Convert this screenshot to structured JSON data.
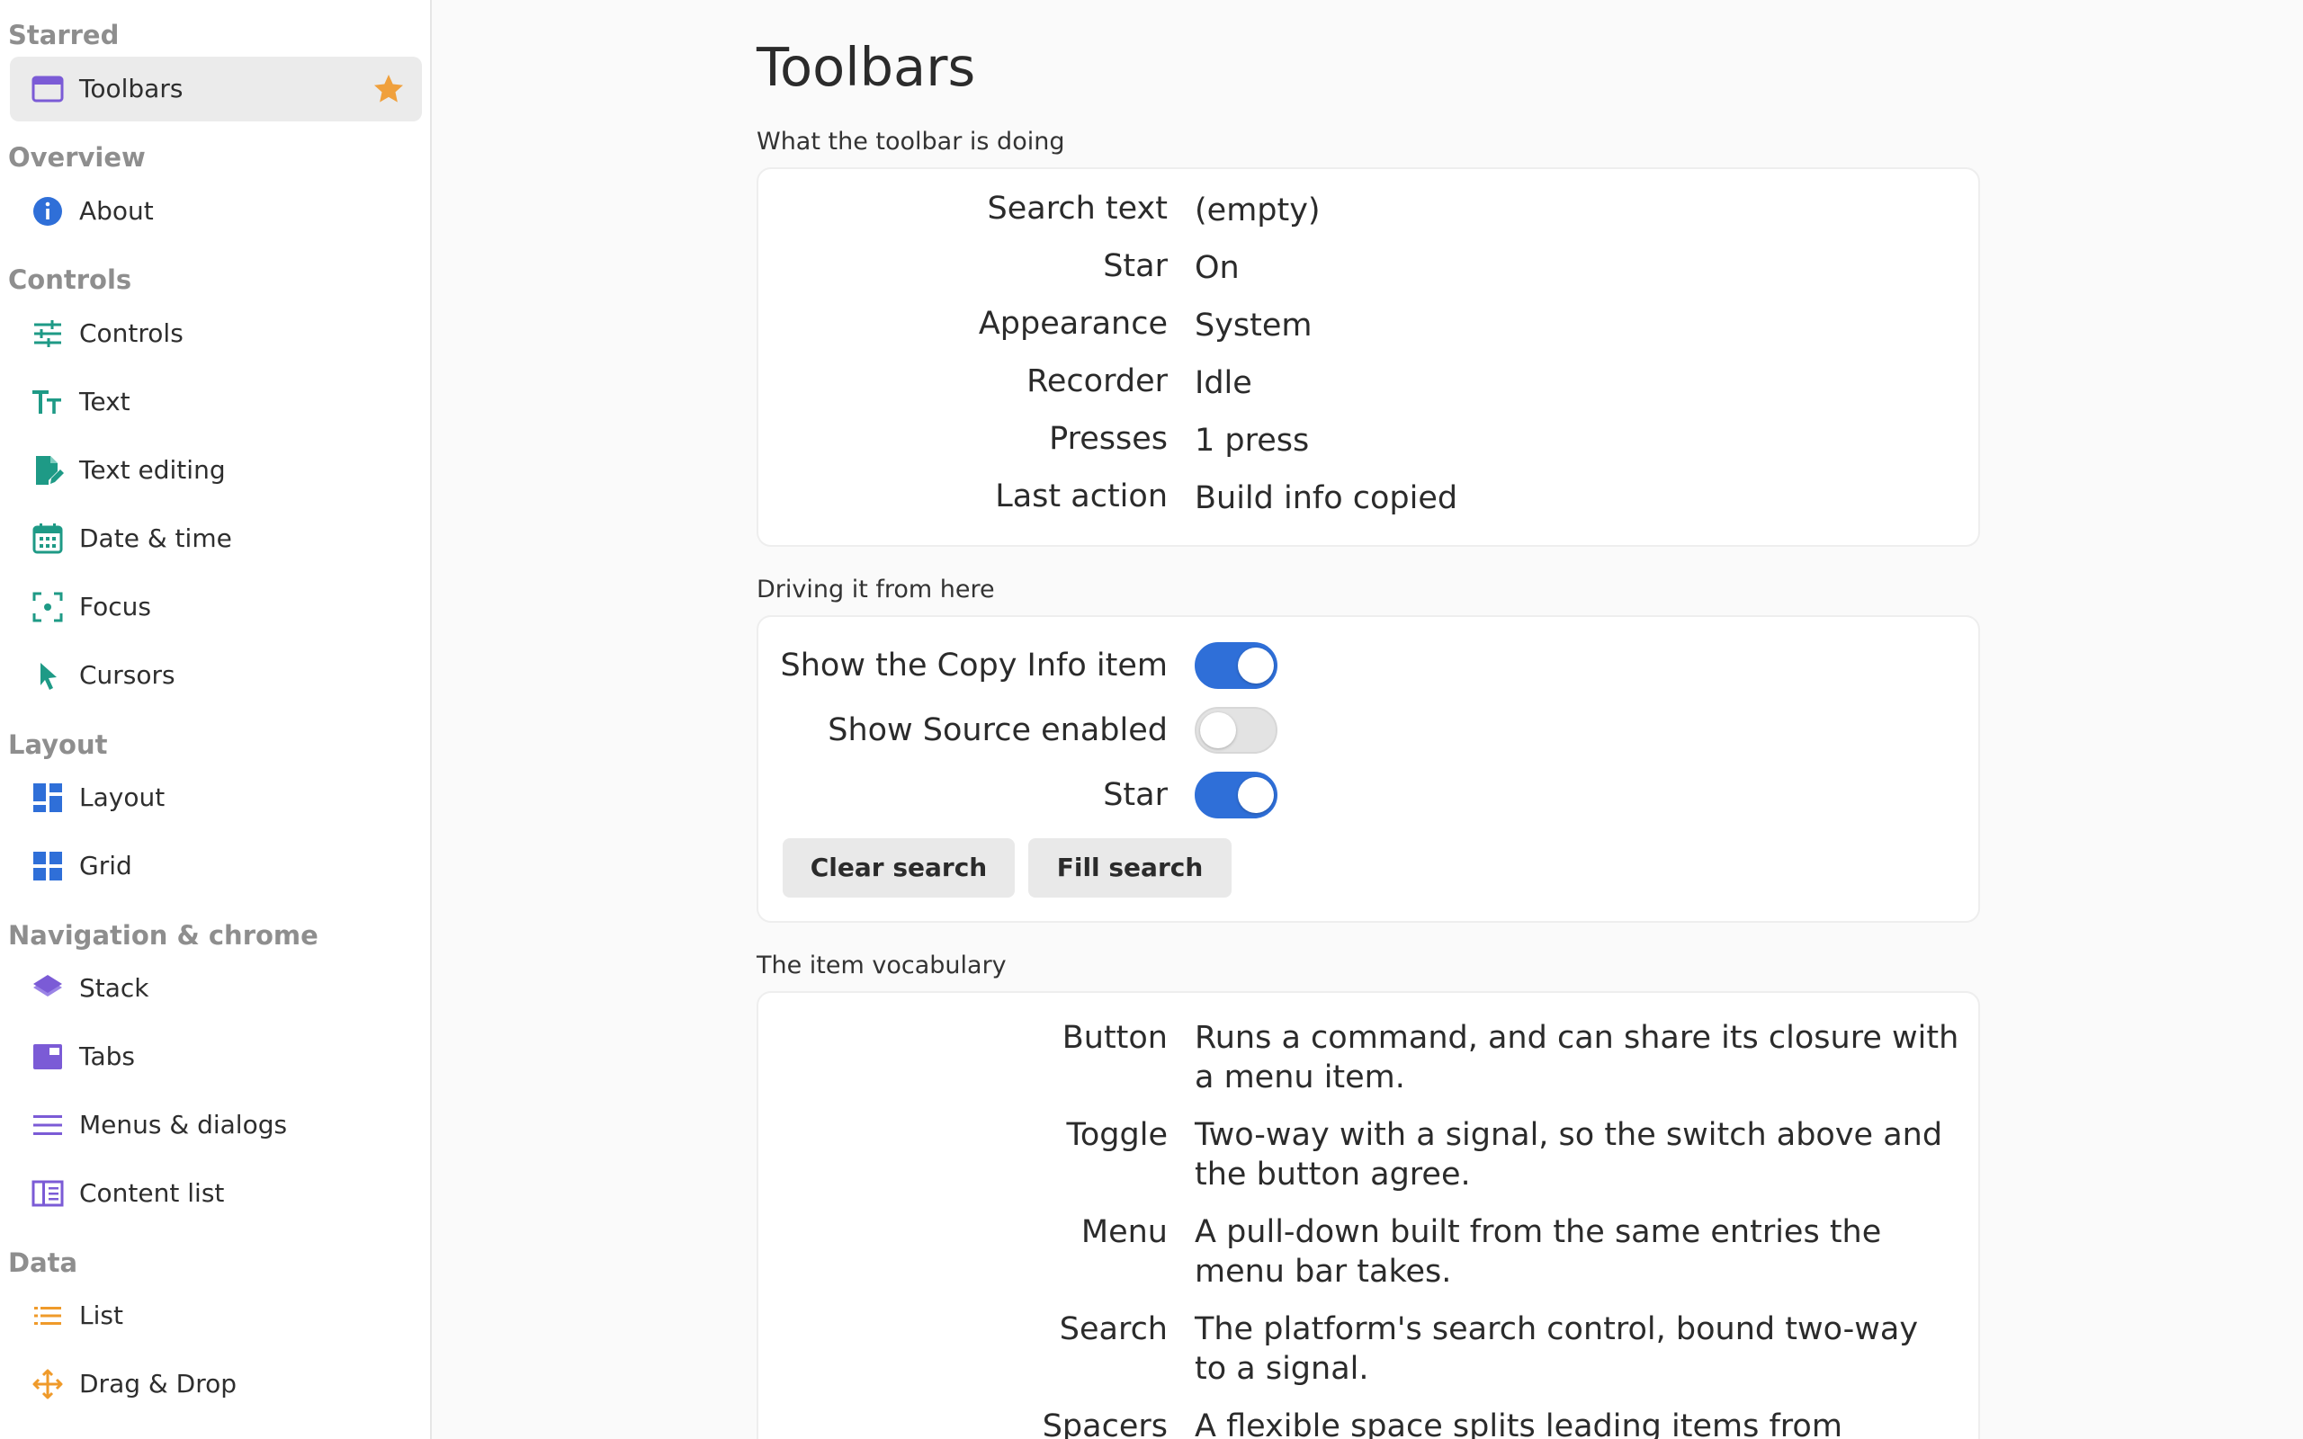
{
  "sidebar": {
    "sections": [
      {
        "title": "Starred",
        "items": [
          {
            "label": "Toolbars",
            "icon": "window-icon",
            "selected": true,
            "starred": true
          }
        ]
      },
      {
        "title": "Overview",
        "items": [
          {
            "label": "About",
            "icon": "info-icon"
          }
        ]
      },
      {
        "title": "Controls",
        "items": [
          {
            "label": "Controls",
            "icon": "sliders-icon"
          },
          {
            "label": "Text",
            "icon": "text-size-icon"
          },
          {
            "label": "Text editing",
            "icon": "document-edit-icon"
          },
          {
            "label": "Date & time",
            "icon": "calendar-icon"
          },
          {
            "label": "Focus",
            "icon": "focus-icon"
          },
          {
            "label": "Cursors",
            "icon": "cursor-icon"
          }
        ]
      },
      {
        "title": "Layout",
        "items": [
          {
            "label": "Layout",
            "icon": "layout-icon"
          },
          {
            "label": "Grid",
            "icon": "grid-icon"
          }
        ]
      },
      {
        "title": "Navigation & chrome",
        "items": [
          {
            "label": "Stack",
            "icon": "stack-icon"
          },
          {
            "label": "Tabs",
            "icon": "tabs-icon"
          },
          {
            "label": "Menus & dialogs",
            "icon": "menu-icon"
          },
          {
            "label": "Content list",
            "icon": "content-list-icon"
          }
        ]
      },
      {
        "title": "Data",
        "items": [
          {
            "label": "List",
            "icon": "list-icon"
          },
          {
            "label": "Drag & Drop",
            "icon": "drag-icon"
          }
        ]
      }
    ]
  },
  "page": {
    "title": "Toolbars",
    "status": {
      "heading": "What the toolbar is doing",
      "rows": [
        {
          "key": "Search text",
          "value": "(empty)"
        },
        {
          "key": "Star",
          "value": "On"
        },
        {
          "key": "Appearance",
          "value": "System"
        },
        {
          "key": "Recorder",
          "value": "Idle"
        },
        {
          "key": "Presses",
          "value": "1 press"
        },
        {
          "key": "Last action",
          "value": "Build info copied"
        }
      ]
    },
    "drive": {
      "heading": "Driving it from here",
      "toggles": [
        {
          "label": "Show the Copy Info item",
          "on": true
        },
        {
          "label": "Show Source enabled",
          "on": false
        },
        {
          "label": "Star",
          "on": true
        }
      ],
      "buttons": [
        "Clear search",
        "Fill search"
      ]
    },
    "vocabulary": {
      "heading": "The item vocabulary",
      "rows": [
        {
          "key": "Button",
          "value": "Runs a command, and can share its closure with a menu item."
        },
        {
          "key": "Toggle",
          "value": "Two-way with a signal, so the switch above and the button agree."
        },
        {
          "key": "Menu",
          "value": "A pull-down built from the same entries the menu bar takes."
        },
        {
          "key": "Search",
          "value": "The platform's search control, bound two-way to a signal."
        },
        {
          "key": "Spacers",
          "value": "A flexible space splits leading items from trailing ones."
        }
      ]
    }
  },
  "colors": {
    "accent": "#2f6fd8",
    "star": "#f0a03c",
    "teal": "#1e9a86",
    "purple": "#7b5bd6",
    "orange": "#ef9a2a"
  }
}
